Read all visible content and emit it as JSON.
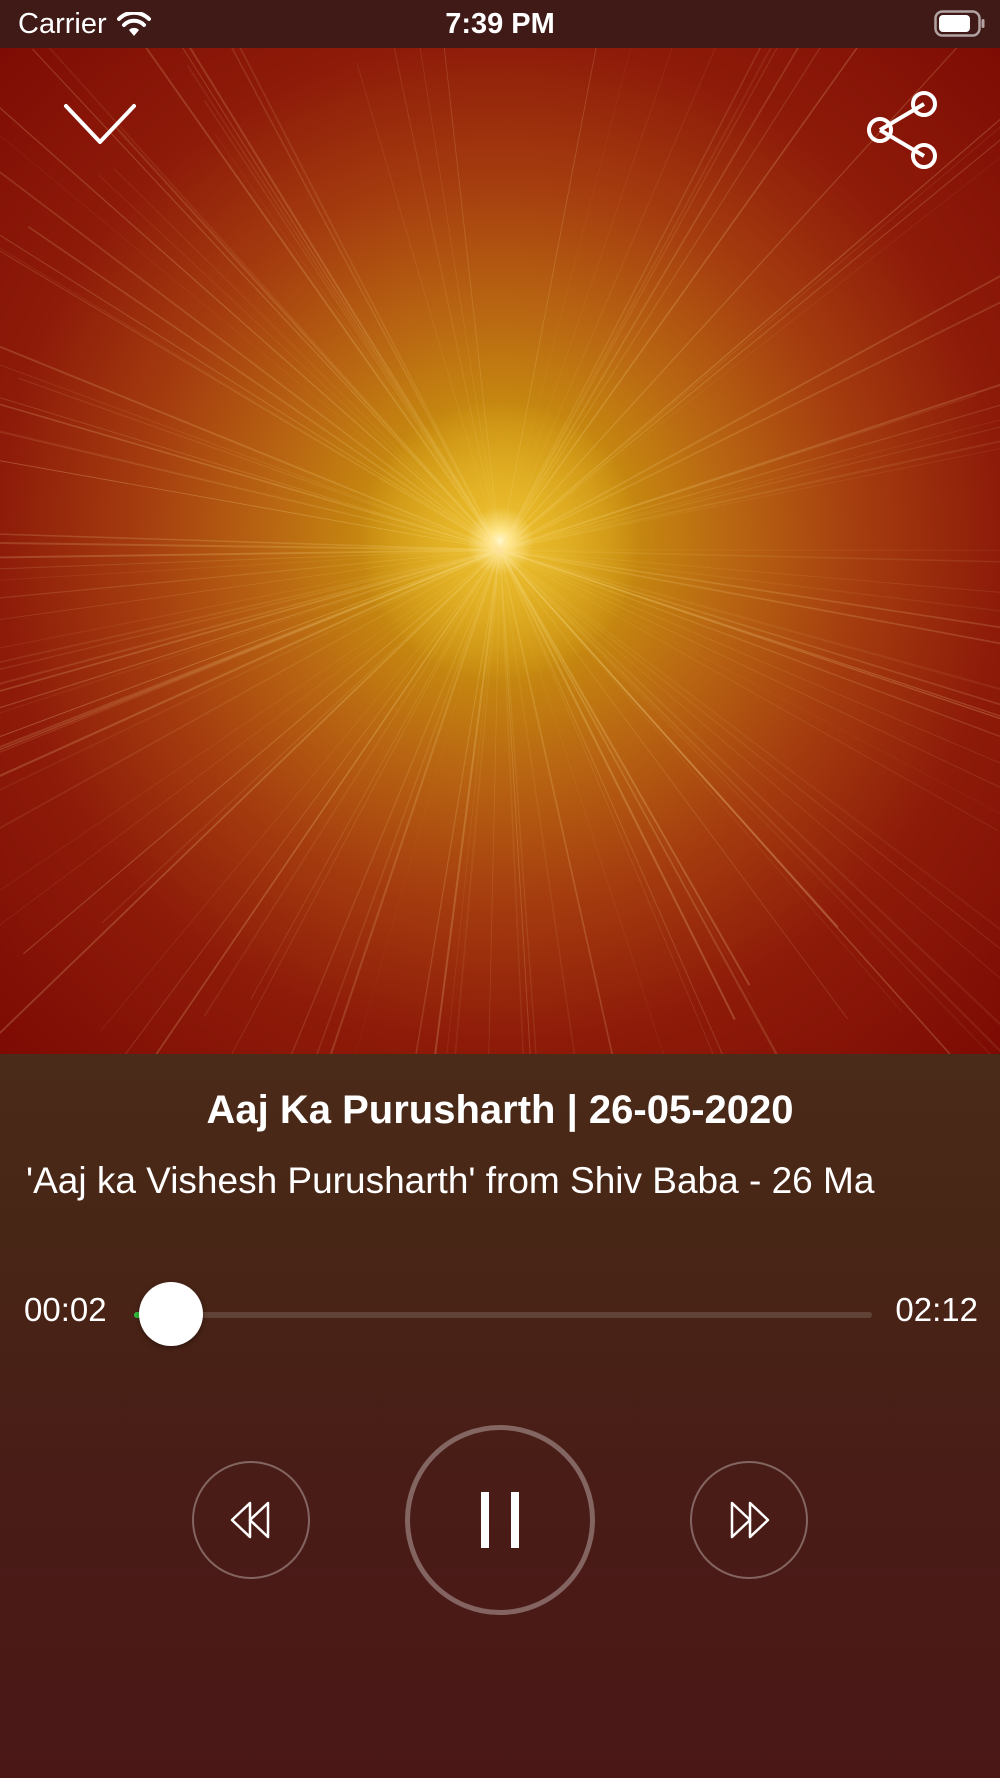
{
  "status_bar": {
    "carrier": "Carrier",
    "time": "7:39 PM",
    "icons": [
      "wifi-icon",
      "battery-icon"
    ]
  },
  "header": {
    "collapse_icon": "chevron-down-icon",
    "share_icon": "share-icon"
  },
  "track": {
    "title": "Aaj Ka Purusharth | 26-05-2020",
    "subtitle": "'Aaj ka Vishesh Purusharth' from Shiv Baba - 26 Ma"
  },
  "progress": {
    "current_time": "00:02",
    "total_time": "02:12",
    "fraction": 0.05,
    "accent": "#2fbd3b"
  },
  "controls": {
    "rewind_icon": "rewind-icon",
    "pause_icon": "pause-icon",
    "forward_icon": "fast-forward-icon"
  },
  "colors": {
    "player_bg": "#4a1a17",
    "artwork_center": "#e8b92a",
    "artwork_edge": "#7d0b04"
  }
}
